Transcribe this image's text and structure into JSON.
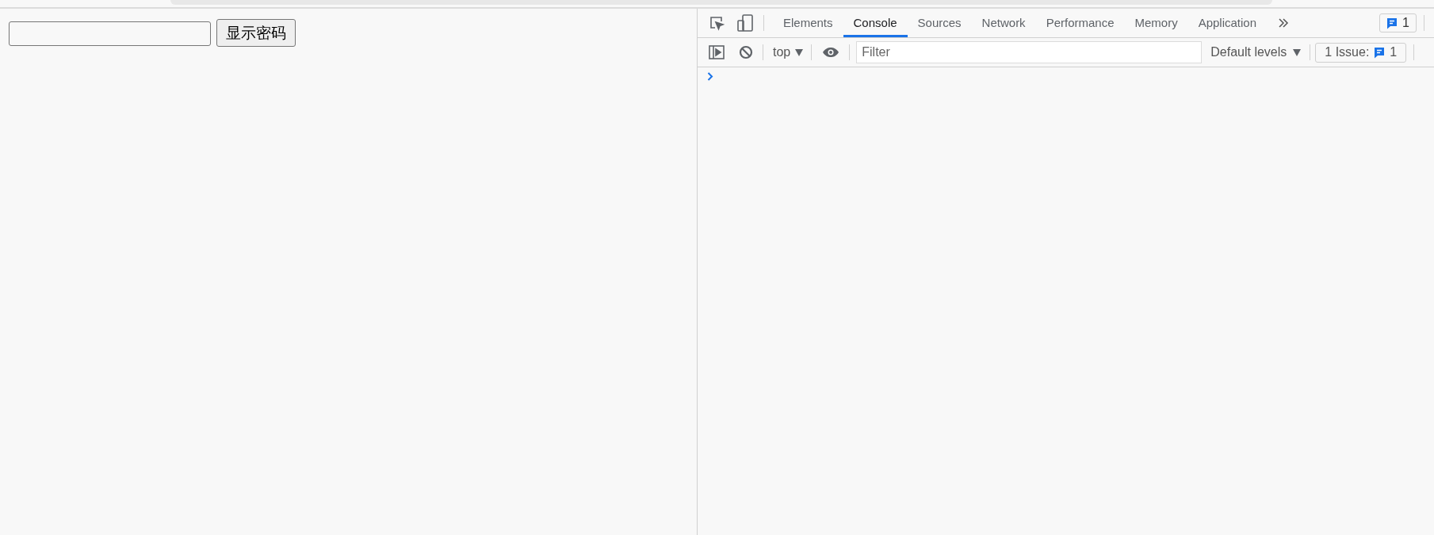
{
  "page": {
    "button": "显示密码"
  },
  "devtools": {
    "tabs": [
      {
        "label": "Elements",
        "selected": false
      },
      {
        "label": "Console",
        "selected": true
      },
      {
        "label": "Sources",
        "selected": false
      },
      {
        "label": "Network",
        "selected": false
      },
      {
        "label": "Performance",
        "selected": false
      },
      {
        "label": "Memory",
        "selected": false
      },
      {
        "label": "Application",
        "selected": false
      }
    ],
    "issues_badge": "1",
    "console_toolbar": {
      "context": "top",
      "filter_placeholder": "Filter",
      "levels": "Default levels",
      "issues_label": "1 Issue:",
      "issues_count": "1"
    }
  }
}
